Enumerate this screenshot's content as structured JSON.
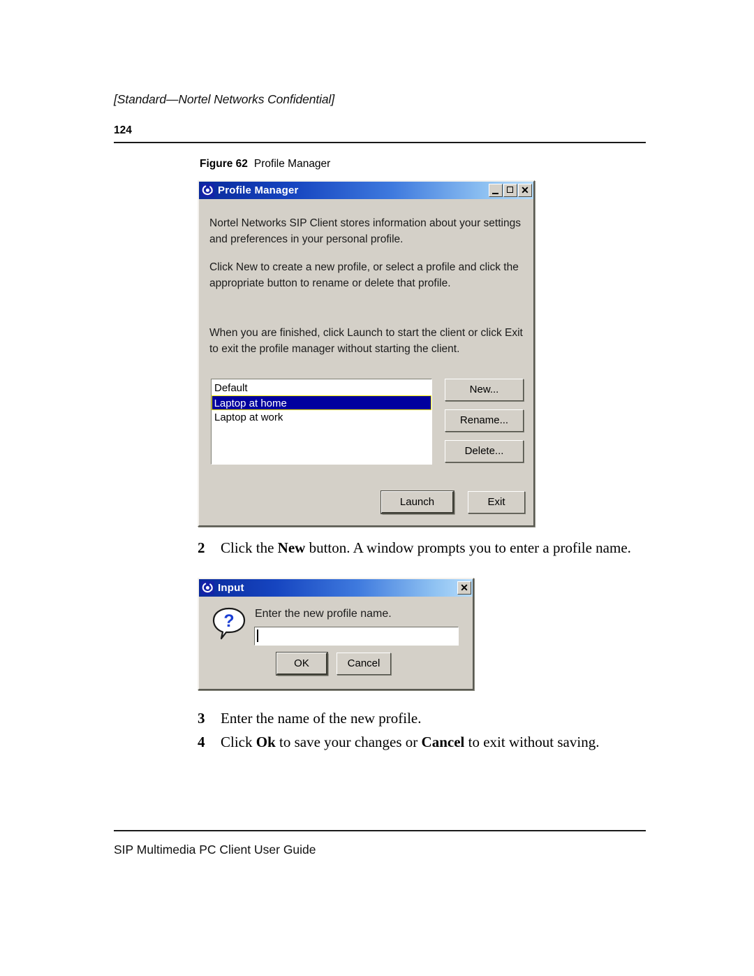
{
  "page": {
    "header_confidential": "[Standard—Nortel Networks Confidential]",
    "page_number": "124",
    "footer_title": "SIP Multimedia PC Client User Guide"
  },
  "figure": {
    "label": "Figure 62",
    "title": "Profile Manager"
  },
  "profile_manager": {
    "title": "Profile Manager",
    "icon": "java-swirl-icon",
    "window_buttons": {
      "minimize": "minimize-icon",
      "maximize": "maximize-icon",
      "close": "close-icon"
    },
    "paragraph_1": "Nortel Networks SIP Client stores information about your settings and preferences in your personal profile.",
    "paragraph_2": "Click New to create a new profile, or select a profile and click the appropriate button to rename or delete that profile.",
    "paragraph_3": "When you are finished, click Launch to start the client or click Exit to exit the profile manager without starting the client.",
    "profiles": [
      {
        "name": "Default",
        "selected": false
      },
      {
        "name": "Laptop at home",
        "selected": true
      },
      {
        "name": "Laptop at work",
        "selected": false
      }
    ],
    "side_buttons": {
      "new": "New...",
      "rename": "Rename...",
      "delete": "Delete..."
    },
    "bottom_buttons": {
      "launch": "Launch",
      "exit": "Exit"
    },
    "colors": {
      "titlebar_start": "#0a2a9c",
      "titlebar_end": "#b6dcfb",
      "dialog_face": "#d4d0c8",
      "selection_bg": "#00009e",
      "selection_border": "#f2e600"
    }
  },
  "steps": {
    "step2": {
      "number": "2",
      "part_a": "Click the ",
      "bold_a": "New",
      "part_b": " button. A window prompts you to enter a profile name."
    },
    "step3": {
      "number": "3",
      "part_a": "Enter the name of the new profile."
    },
    "step4": {
      "number": "4",
      "part_a": "Click ",
      "bold_a": "Ok",
      "part_b": " to save your changes or ",
      "bold_b": "Cancel",
      "part_c": " to exit without saving."
    }
  },
  "input_dialog": {
    "title": "Input",
    "icon": "java-swirl-icon",
    "close_button": "close-icon",
    "message_icon": "question-bubble-icon",
    "message": "Enter the new profile name.",
    "field_value": "",
    "field_placeholder": "",
    "buttons": {
      "ok": "OK",
      "cancel": "Cancel"
    }
  }
}
